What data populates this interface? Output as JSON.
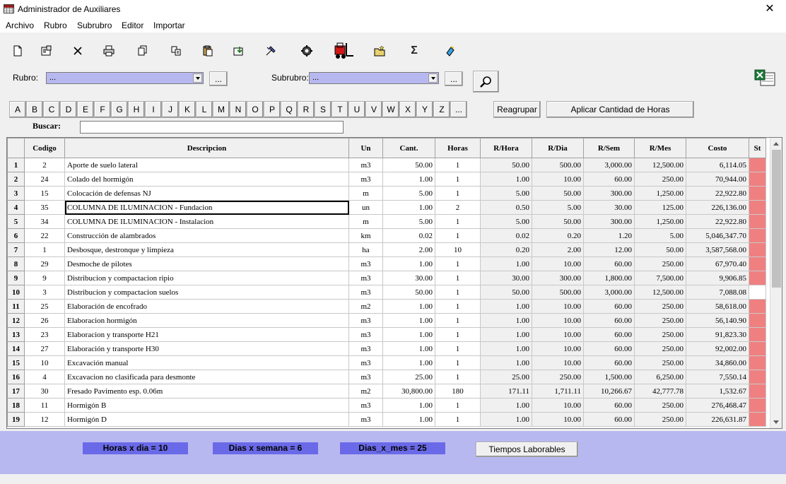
{
  "window": {
    "title": "Administrador de Auxiliares",
    "close": "✕"
  },
  "menu": [
    "Archivo",
    "Rubro",
    "Subrubro",
    "Editor",
    "Importar"
  ],
  "toolbar": [
    "new-doc-icon",
    "properties-icon",
    "delete-icon",
    "print-icon",
    "copy-icon",
    "duplicate-icon",
    "paste-icon",
    "import-icon",
    "tools-icon",
    "gear-icon",
    "forklift-icon",
    "new-folder-icon",
    "sigma-icon",
    "refresh-icon"
  ],
  "filters": {
    "rubro_label": "Rubro:",
    "rubro_value": "...",
    "subrubro_label": "Subrubro:",
    "subrubro_value": "...",
    "browse_label": "..."
  },
  "letters": [
    "A",
    "B",
    "C",
    "D",
    "E",
    "F",
    "G",
    "H",
    "I",
    "J",
    "K",
    "L",
    "M",
    "N",
    "O",
    "P",
    "Q",
    "R",
    "S",
    "T",
    "U",
    "V",
    "W",
    "X",
    "Y",
    "Z",
    "..."
  ],
  "buttons": {
    "reagrupar": "Reagrupar",
    "aplicar": "Aplicar Cantidad de Horas",
    "tiempos": "Tiempos Laborables"
  },
  "search": {
    "label": "Buscar:",
    "value": ""
  },
  "columns": [
    "Codigo",
    "Descripcion",
    "Un",
    "Cant.",
    "Horas",
    "R/Hora",
    "R/Dia",
    "R/Sem",
    "R/Mes",
    "Costo",
    "St"
  ],
  "rows": [
    {
      "n": "1",
      "codigo": "2",
      "desc": "Aporte de suelo lateral",
      "un": "m3",
      "cant": "50.00",
      "horas": "1",
      "rhora": "50.00",
      "rdia": "500.00",
      "rsem": "3,000.00",
      "rmes": "12,500.00",
      "costo": "6,114.05",
      "st": "red"
    },
    {
      "n": "2",
      "codigo": "24",
      "desc": "Colado del hormigón",
      "un": "m3",
      "cant": "1.00",
      "horas": "1",
      "rhora": "1.00",
      "rdia": "10.00",
      "rsem": "60.00",
      "rmes": "250.00",
      "costo": "70,944.00",
      "st": "red"
    },
    {
      "n": "3",
      "codigo": "15",
      "desc": "Colocación de defensas NJ",
      "un": "m",
      "cant": "5.00",
      "horas": "1",
      "rhora": "5.00",
      "rdia": "50.00",
      "rsem": "300.00",
      "rmes": "1,250.00",
      "costo": "22,922.80",
      "st": "red"
    },
    {
      "n": "4",
      "codigo": "35",
      "desc": "COLUMNA DE ILUMINACION - Fundacion",
      "un": "un",
      "cant": "1.00",
      "horas": "2",
      "rhora": "0.50",
      "rdia": "5.00",
      "rsem": "30.00",
      "rmes": "125.00",
      "costo": "226,136.00",
      "st": "red"
    },
    {
      "n": "5",
      "codigo": "34",
      "desc": "COLUMNA DE ILUMINACION - Instalacion",
      "un": "m",
      "cant": "5.00",
      "horas": "1",
      "rhora": "5.00",
      "rdia": "50.00",
      "rsem": "300.00",
      "rmes": "1,250.00",
      "costo": "22,922.80",
      "st": "red"
    },
    {
      "n": "6",
      "codigo": "22",
      "desc": "Construcción de alambrados",
      "un": "km",
      "cant": "0.02",
      "horas": "1",
      "rhora": "0.02",
      "rdia": "0.20",
      "rsem": "1.20",
      "rmes": "5.00",
      "costo": "5,046,347.70",
      "st": "red"
    },
    {
      "n": "7",
      "codigo": "1",
      "desc": "Desbosque, destronque y limpieza",
      "un": "ha",
      "cant": "2.00",
      "horas": "10",
      "rhora": "0.20",
      "rdia": "2.00",
      "rsem": "12.00",
      "rmes": "50.00",
      "costo": "3,587,568.00",
      "st": "red"
    },
    {
      "n": "8",
      "codigo": "29",
      "desc": "Desmoche de pilotes",
      "un": "m3",
      "cant": "1.00",
      "horas": "1",
      "rhora": "1.00",
      "rdia": "10.00",
      "rsem": "60.00",
      "rmes": "250.00",
      "costo": "67,970.40",
      "st": "red"
    },
    {
      "n": "9",
      "codigo": "9",
      "desc": "Distribucion y compactacion ripio",
      "un": "m3",
      "cant": "30.00",
      "horas": "1",
      "rhora": "30.00",
      "rdia": "300.00",
      "rsem": "1,800.00",
      "rmes": "7,500.00",
      "costo": "9,906.85",
      "st": "red"
    },
    {
      "n": "10",
      "codigo": "3",
      "desc": "Distribucion y compactacion suelos",
      "un": "m3",
      "cant": "50.00",
      "horas": "1",
      "rhora": "50.00",
      "rdia": "500.00",
      "rsem": "3,000.00",
      "rmes": "12,500.00",
      "costo": "7,088.08",
      "st": "white"
    },
    {
      "n": "11",
      "codigo": "25",
      "desc": "Elaboración de encofrado",
      "un": "m2",
      "cant": "1.00",
      "horas": "1",
      "rhora": "1.00",
      "rdia": "10.00",
      "rsem": "60.00",
      "rmes": "250.00",
      "costo": "58,618.00",
      "st": "red"
    },
    {
      "n": "12",
      "codigo": "26",
      "desc": "Elaboracion hormigón",
      "un": "m3",
      "cant": "1.00",
      "horas": "1",
      "rhora": "1.00",
      "rdia": "10.00",
      "rsem": "60.00",
      "rmes": "250.00",
      "costo": "56,140.90",
      "st": "red"
    },
    {
      "n": "13",
      "codigo": "23",
      "desc": "Elaboracion y transporte H21",
      "un": "m3",
      "cant": "1.00",
      "horas": "1",
      "rhora": "1.00",
      "rdia": "10.00",
      "rsem": "60.00",
      "rmes": "250.00",
      "costo": "91,823.30",
      "st": "red"
    },
    {
      "n": "14",
      "codigo": "27",
      "desc": "Elaboración y transporte H30",
      "un": "m3",
      "cant": "1.00",
      "horas": "1",
      "rhora": "1.00",
      "rdia": "10.00",
      "rsem": "60.00",
      "rmes": "250.00",
      "costo": "92,002.00",
      "st": "red"
    },
    {
      "n": "15",
      "codigo": "10",
      "desc": "Excavación manual",
      "un": "m3",
      "cant": "1.00",
      "horas": "1",
      "rhora": "1.00",
      "rdia": "10.00",
      "rsem": "60.00",
      "rmes": "250.00",
      "costo": "34,860.00",
      "st": "red"
    },
    {
      "n": "16",
      "codigo": "4",
      "desc": "Excavacion no clasificada para desmonte",
      "un": "m3",
      "cant": "25.00",
      "horas": "1",
      "rhora": "25.00",
      "rdia": "250.00",
      "rsem": "1,500.00",
      "rmes": "6,250.00",
      "costo": "7,550.14",
      "st": "red"
    },
    {
      "n": "17",
      "codigo": "30",
      "desc": "Fresado Pavimento esp. 0.06m",
      "un": "m2",
      "cant": "30,800.00",
      "horas": "180",
      "rhora": "171.11",
      "rdia": "1,711.11",
      "rsem": "10,266.67",
      "rmes": "42,777.78",
      "costo": "1,532.67",
      "st": "red"
    },
    {
      "n": "18",
      "codigo": "11",
      "desc": "Hormigón B",
      "un": "m3",
      "cant": "1.00",
      "horas": "1",
      "rhora": "1.00",
      "rdia": "10.00",
      "rsem": "60.00",
      "rmes": "250.00",
      "costo": "276,468.47",
      "st": "red"
    },
    {
      "n": "19",
      "codigo": "12",
      "desc": "Hormigón D",
      "un": "m3",
      "cant": "1.00",
      "horas": "1",
      "rhora": "1.00",
      "rdia": "10.00",
      "rsem": "60.00",
      "rmes": "250.00",
      "costo": "226,631.87",
      "st": "red"
    }
  ],
  "footer": {
    "horas_dia": "Horas x dia = 10",
    "dias_semana": "Dias x semana = 6",
    "dias_mes": "Dias_x_mes = 25"
  }
}
